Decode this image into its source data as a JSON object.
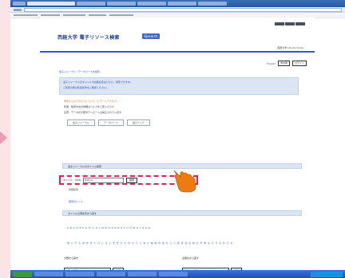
{
  "site": {
    "title": "西経大学 電子リソース検索",
    "badge": "EJsearch",
    "header_right": "西経大学 Library home",
    "top_links": {
      "text": "English",
      "btn1": "学内者",
      "btn2": "ログイン"
    }
  },
  "notice": {
    "link": "電子ジャーナル・データベースを検索",
    "line1": "電子ジャーナルのタイトルや出版社名などから、検索できます。",
    "line2": "ご利用の際は利用条件をご確認ください。"
  },
  "bullets": [
    {
      "text": "学外からのアクセスについて（リモートアクセス）",
      "style": "red"
    },
    {
      "text": "利用：検索方法の詳細はヘルプをご覧ください",
      "style": "normal"
    },
    {
      "text": "注意：データの大量ダウンロードは禁止されています",
      "style": "normal"
    }
  ],
  "tabs": [
    "電子ジャーナル",
    "データベース",
    "電子ブック"
  ],
  "sections": {
    "journal_search": "電子ジャーナルのタイトル検索",
    "alpha_search": "タイトルの頭文字から探す"
  },
  "search": {
    "label": "タイトル・ISSN",
    "value": "Nature",
    "button": "検索"
  },
  "misc": {
    "advanced": "詳細検索",
    "help": "検索のヒント"
  },
  "alpha_en": "A B C D E F G H I J K L M N O P Q R S T U V W X Y Z 0-9",
  "alpha_ja": "あ い う え お か き く け こ さ し す せ そ た ち つ て と な に ぬ ね の は ひ ふ へ ほ ま み む め も や ゆ よ ら り る れ ろ わ",
  "panes": {
    "left": {
      "heading": "分野から探す",
      "select": "分野を選択してください",
      "button": "表示"
    },
    "right": {
      "heading": "出版社から探す",
      "select": "出版社を選択してください",
      "button": "表示"
    }
  },
  "colors": {
    "highlight": "#e0205a",
    "pointer": "#ee7a12",
    "accent": "#3b5aa8"
  },
  "icons": {
    "pointer": "hand-pointer-icon",
    "side": "arrow-right-icon"
  }
}
